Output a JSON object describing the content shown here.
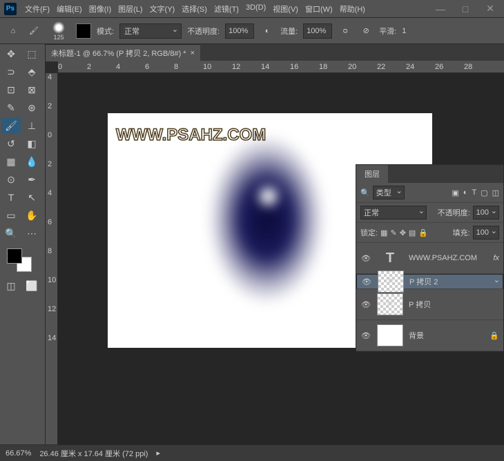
{
  "menu": {
    "file": "文件(F)",
    "edit": "编辑(E)",
    "image": "图像(I)",
    "layer": "图层(L)",
    "text": "文字(Y)",
    "select": "选择(S)",
    "filter": "滤镜(T)",
    "3d": "3D(D)",
    "view": "视图(V)",
    "window": "窗口(W)",
    "help": "帮助(H)"
  },
  "options": {
    "brushSize": "125",
    "modeLbl": "模式:",
    "mode": "正常",
    "opacityLbl": "不透明度:",
    "opacity": "100%",
    "flowLbl": "流量:",
    "flow": "100%",
    "smoothLbl": "平滑:",
    "smooth": "1"
  },
  "doc": {
    "title": "未标题-1 @ 66.7% (P 拷贝 2, RGB/8#) *"
  },
  "rulerH": [
    "0",
    "2",
    "4",
    "6",
    "8",
    "10",
    "12",
    "14",
    "16",
    "18",
    "20",
    "22",
    "24",
    "26",
    "28"
  ],
  "rulerV": [
    "4",
    "2",
    "0",
    "2",
    "4",
    "6",
    "8",
    "10",
    "12",
    "14"
  ],
  "canvas": {
    "watermark": "WWW.PSAHZ.COM"
  },
  "layersPanel": {
    "title": "图层",
    "typeLbl": "类型",
    "blend": "正常",
    "opacityLbl": "不透明度:",
    "opacity": "100",
    "lockLbl": "锁定:",
    "fillLbl": "填充:",
    "fill": "100",
    "layers": [
      {
        "name": "WWW.PSAHZ.COM",
        "type": "text",
        "fx": "fx"
      },
      {
        "name": "P 拷贝 2",
        "type": "p",
        "selected": true
      },
      {
        "name": "P 拷贝",
        "type": "p"
      },
      {
        "name": "背景",
        "type": "bg",
        "lock": true
      }
    ]
  },
  "status": {
    "zoom": "66.67%",
    "dims": "26.46 厘米 x 17.64 厘米 (72 ppi)"
  }
}
